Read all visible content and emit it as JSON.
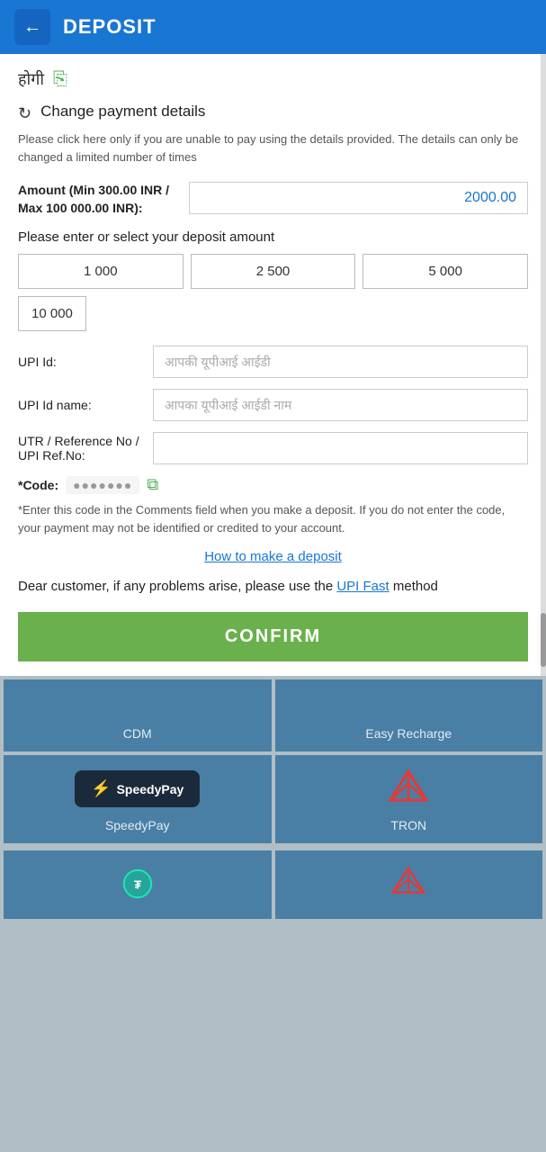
{
  "header": {
    "title": "DEPOSIT",
    "back_label": "←"
  },
  "top": {
    "partial_text": "होगी",
    "share_icon": "⎘"
  },
  "change_payment": {
    "label": "Change payment details",
    "note": "Please click here only if you are unable to pay using the details provided. The details can only be changed a limited number of times",
    "refresh_icon": "↻"
  },
  "amount_section": {
    "label": "Amount (Min 300.00 INR / Max 100 000.00 INR):",
    "value": "2000.00",
    "select_text": "Please enter or select your deposit amount",
    "quick_amounts": [
      "1 000",
      "2 500",
      "5 000",
      "10 000"
    ]
  },
  "fields": {
    "upi_id_label": "UPI Id:",
    "upi_id_placeholder": "आपकी यूपीआई आईडी",
    "upi_id_name_label": "UPI Id name:",
    "upi_id_name_placeholder": "आपका यूपीआई आईडी नाम",
    "utr_label": "UTR / Reference No / UPI Ref.No:",
    "utr_placeholder": ""
  },
  "code": {
    "label": "*Code:",
    "value": "●●●●●●●",
    "copy_icon": "⧉"
  },
  "code_note": "*Enter this code in the Comments field when you make a deposit. If you do not enter the code, your payment may not be identified or credited to your account.",
  "how_to_link": "How to make a deposit",
  "customer_note": {
    "prefix": "Dear customer, if any problems arise, please use the ",
    "link_text": "UPI Fast",
    "suffix": " method"
  },
  "confirm_btn": "CONFIRM",
  "payment_methods": [
    {
      "id": "cdm",
      "label": "CDM",
      "icon_type": "text"
    },
    {
      "id": "easy-recharge",
      "label": "Easy Recharge",
      "icon_type": "text"
    },
    {
      "id": "speedypay",
      "label": "SpeedyPay",
      "icon_type": "speedy"
    },
    {
      "id": "tron",
      "label": "TRON",
      "icon_type": "tron"
    }
  ],
  "bottom_partial": {
    "visible": true
  }
}
